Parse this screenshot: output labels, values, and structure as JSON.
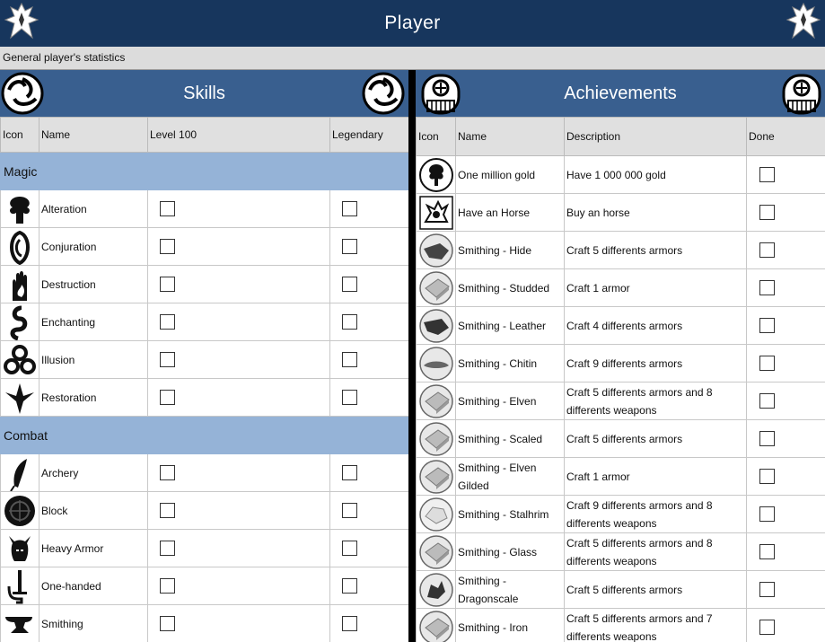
{
  "header": {
    "title": "Player",
    "subtitle": "General player's statistics"
  },
  "skills": {
    "title": "Skills",
    "columns": {
      "icon": "Icon",
      "name": "Name",
      "level": "Level 100",
      "legendary": "Legendary"
    },
    "categories": [
      {
        "name": "Magic",
        "items": [
          {
            "name": "Alteration",
            "icon": "tree-icon"
          },
          {
            "name": "Conjuration",
            "icon": "conjuration-icon"
          },
          {
            "name": "Destruction",
            "icon": "flame-hand-icon"
          },
          {
            "name": "Enchanting",
            "icon": "serpent-icon"
          },
          {
            "name": "Illusion",
            "icon": "triple-ring-icon"
          },
          {
            "name": "Restoration",
            "icon": "restoration-icon"
          }
        ]
      },
      {
        "name": "Combat",
        "items": [
          {
            "name": "Archery",
            "icon": "feather-icon"
          },
          {
            "name": "Block",
            "icon": "shield-icon"
          },
          {
            "name": "Heavy Armor",
            "icon": "helmet-icon"
          },
          {
            "name": "One-handed",
            "icon": "sword-icon"
          },
          {
            "name": "Smithing",
            "icon": "anvil-icon"
          }
        ]
      }
    ]
  },
  "achievements": {
    "title": "Achievements",
    "columns": {
      "icon": "Icon",
      "name": "Name",
      "description": "Description",
      "done": "Done"
    },
    "items": [
      {
        "name": "One million gold",
        "description": "Have 1 000 000 gold",
        "icon": "gold-tree-icon"
      },
      {
        "name": "Have an Horse",
        "description": "Buy an horse",
        "icon": "horse-icon"
      },
      {
        "name": "Smithing - Hide",
        "description": "Craft 5 differents armors",
        "icon": "hide-ingot-icon"
      },
      {
        "name": "Smithing - Studded",
        "description": "Craft 1 armor",
        "icon": "ingot-icon"
      },
      {
        "name": "Smithing - Leather",
        "description": "Craft 4 differents armors",
        "icon": "leather-ingot-icon"
      },
      {
        "name": "Smithing - Chitin",
        "description": "Craft 9 differents armors",
        "icon": "chitin-ingot-icon"
      },
      {
        "name": "Smithing - Elven",
        "description": "Craft 5 differents armors and 8 differents weapons",
        "icon": "ingot-icon"
      },
      {
        "name": "Smithing - Scaled",
        "description": "Craft 5 differents armors",
        "icon": "ingot-icon"
      },
      {
        "name": "Smithing - Elven Gilded",
        "description": "Craft 1 armor",
        "icon": "ingot-icon"
      },
      {
        "name": "Smithing - Stalhrim",
        "description": "Craft 9 differents armors and 8 differents weapons",
        "icon": "stalhrim-ingot-icon"
      },
      {
        "name": "Smithing - Glass",
        "description": "Craft 5 differents armors and 8 differents weapons",
        "icon": "ingot-icon"
      },
      {
        "name": "Smithing - Dragonscale",
        "description": "Craft 5 differents armors",
        "icon": "dragon-ingot-icon"
      },
      {
        "name": "Smithing - Iron",
        "description": "Craft 5 differents armors and 7 differents weapons",
        "icon": "ingot-icon"
      }
    ]
  },
  "colors": {
    "title_bar": "#17365d",
    "panel_header": "#395f8f",
    "category_row": "#95b3d7",
    "subheader": "#dcdcdc"
  }
}
